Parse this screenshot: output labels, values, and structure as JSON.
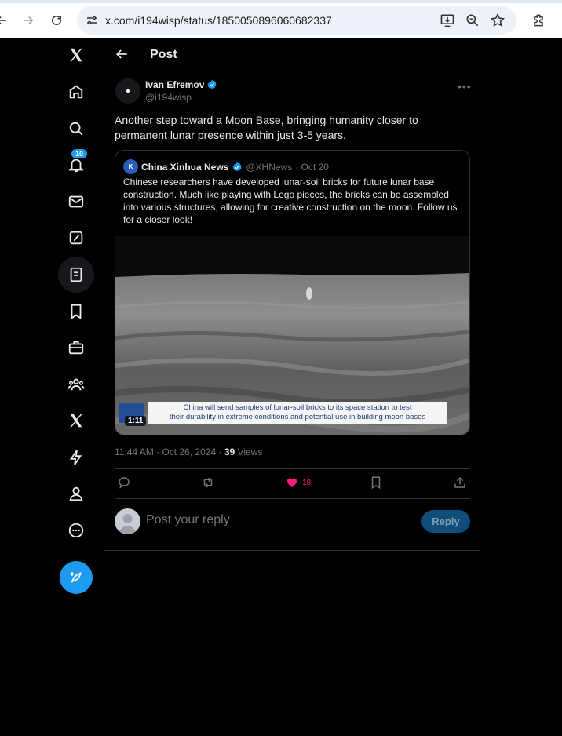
{
  "browser": {
    "url": "x.com/i194wisp/status/1850050896060682337"
  },
  "nav": {
    "notification_count": "10"
  },
  "header": {
    "title": "Post"
  },
  "post": {
    "author_name": "Ivan Efremov",
    "author_handle": "@i194wisp",
    "text": "Another step toward a Moon Base, bringing humanity closer to permanent lunar presence within just 3-5 years.",
    "time": "11:44 AM · Oct 26, 2024 · ",
    "views_count": "39",
    "views_label": " Views",
    "likes": "18"
  },
  "quote": {
    "avatar_text": "K",
    "name": "China Xinhua News",
    "handle": "@XHNews",
    "date": "· Oct 20",
    "text": "Chinese researchers have developed lunar-soil bricks for future lunar base construction. Much like playing with Lego pieces, the bricks can be assembled into various structures, allowing for creative construction on the moon. Follow us for a closer look!",
    "video_duration": "1:11",
    "video_caption_line1": "China will send samples of lunar-soil bricks to its space station to test",
    "video_caption_line2": "their durability in extreme conditions and potential use in building moon bases"
  },
  "reply": {
    "placeholder": "Post your reply",
    "button_label": "Reply"
  },
  "colors": {
    "accent": "#1d9bf0",
    "like": "#f91880",
    "background": "#000000",
    "border": "#2f3336"
  }
}
